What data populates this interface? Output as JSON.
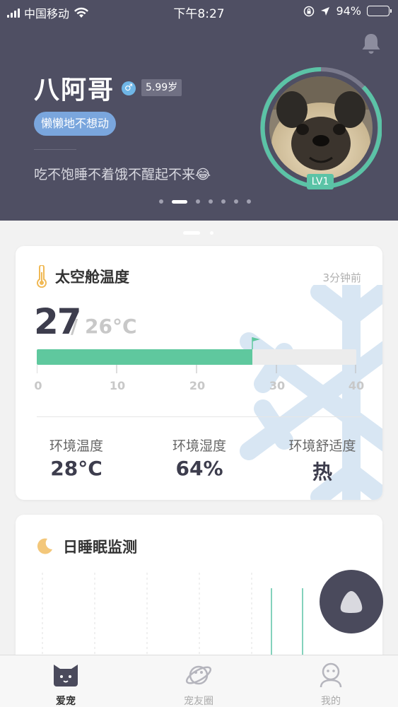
{
  "status_bar": {
    "carrier": "中国移动",
    "time": "下午8:27",
    "battery": "94%",
    "battery_level": 0.94
  },
  "profile": {
    "name": "八阿哥",
    "gender_symbol": "♂",
    "age": "5.99岁",
    "mood": "懒懒地不想动",
    "tagline": "吃不饱睡不着饿不醒起不来😂",
    "level": "LV1",
    "banner_pages": 7,
    "banner_active_index": 1
  },
  "temperature_card": {
    "title": "太空舱温度",
    "updated": "3分钟前",
    "current": "27",
    "target": "/ 26°C",
    "current_value": 27,
    "scale_min": 0,
    "scale_max": 40,
    "scale_ticks": [
      "0",
      "10",
      "20",
      "30",
      "40"
    ],
    "stats": [
      {
        "label": "环境温度",
        "value": "28°C"
      },
      {
        "label": "环境湿度",
        "value": "64%"
      },
      {
        "label": "环境舒适度",
        "value": "热"
      }
    ],
    "colors": {
      "fill": "#5fc89e",
      "track": "#ececec"
    }
  },
  "sleep_card": {
    "title": "日睡眠监测"
  },
  "tab_bar": {
    "tabs": [
      {
        "label": "爱宠",
        "icon": "cat-face-icon",
        "active": true
      },
      {
        "label": "宠友圈",
        "icon": "planet-icon",
        "active": false
      },
      {
        "label": "我的",
        "icon": "user-icon",
        "active": false
      }
    ]
  },
  "colors": {
    "header_bg": "#4f4f63",
    "accent_teal": "#5bc3a6",
    "mood_blue": "#7aa6dd"
  }
}
